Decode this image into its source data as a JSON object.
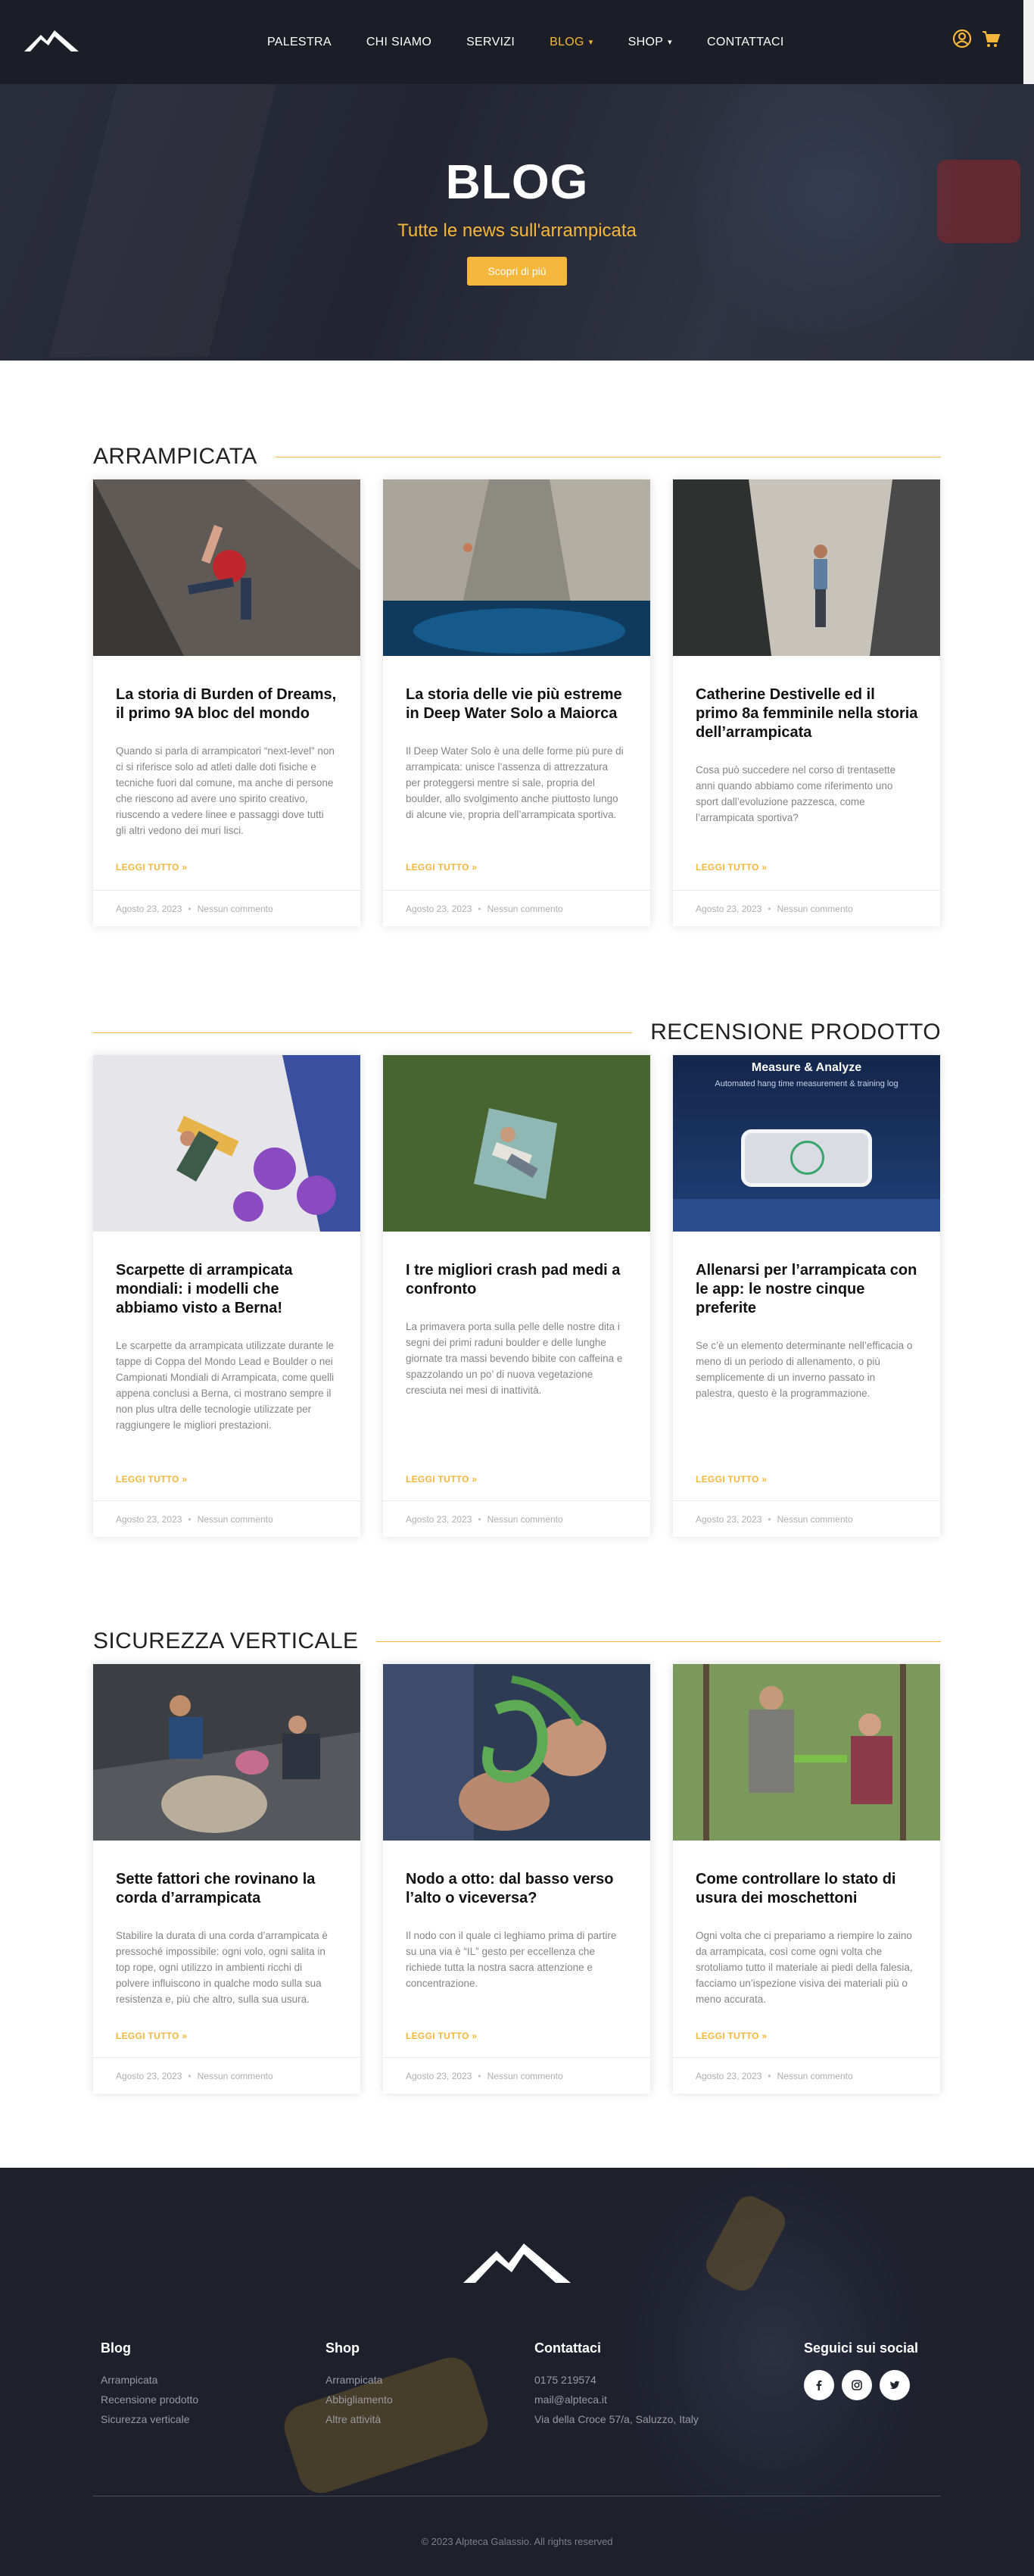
{
  "header": {
    "nav": [
      {
        "label": "PALESTRA"
      },
      {
        "label": "CHI SIAMO"
      },
      {
        "label": "SERVIZI"
      },
      {
        "label": "BLOG"
      },
      {
        "label": "SHOP"
      },
      {
        "label": "CONTATTACI"
      }
    ],
    "accent_color": "#f5b73b",
    "icons": [
      "user-icon",
      "cart-icon"
    ]
  },
  "hero": {
    "title": "BLOG",
    "subtitle": "Tutte le news sull'arrampicata",
    "button_label": "Scopri di più"
  },
  "sections": [
    {
      "title": "ARRAMPICATA",
      "cards": [
        {
          "title": "La storia di Burden of Dreams, il primo 9A bloc del mondo",
          "excerpt": "Quando si parla di arrampicatori “next-level” non ci si riferisce solo ad atleti dalle doti fisiche e tecniche fuori dal comune, ma anche di persone che riescono ad avere uno spirito creativo, riuscendo a vedere linee e passaggi dove tutti gli altri vedono dei muri lisci.",
          "read_more": "LEGGI TUTTO »",
          "date": "Agosto 23, 2023",
          "comments": "Nessun commento"
        },
        {
          "title": "La storia delle vie più estreme in Deep Water Solo a Maiorca",
          "excerpt": "Il Deep Water Solo è una delle forme più pure di arrampicata: unisce l’assenza di attrezzatura per proteggersi mentre si sale, propria del boulder, allo svolgimento anche piuttosto lungo di alcune vie, propria dell’arrampicata sportiva.",
          "read_more": "LEGGI TUTTO »",
          "date": "Agosto 23, 2023",
          "comments": "Nessun commento"
        },
        {
          "title": "Catherine Destivelle ed il primo 8a femminile nella storia dell’arrampicata",
          "excerpt": "Cosa può succedere nel corso di trentasette anni quando abbiamo come riferimento uno sport dall’evoluzione pazzesca, come l’arrampicata sportiva?",
          "read_more": "LEGGI TUTTO »",
          "date": "Agosto 23, 2023",
          "comments": "Nessun commento"
        }
      ]
    },
    {
      "title": "RECENSIONE PRODOTTO",
      "cards": [
        {
          "title": "Scarpette di arrampicata mondiali: i modelli che abbiamo visto a Berna!",
          "excerpt": "Le scarpette da arrampicata utilizzate durante le tappe di Coppa del Mondo Lead e Boulder o nei Campionati Mondiali di Arrampicata, come quelli appena conclusi a Berna, ci mostrano sempre il non plus ultra delle tecnologie utilizzate per raggiungere le migliori prestazioni.",
          "read_more": "LEGGI TUTTO »",
          "date": "Agosto 23, 2023",
          "comments": "Nessun commento"
        },
        {
          "title": "I tre migliori crash pad medi a confronto",
          "excerpt": "La primavera porta sulla pelle delle nostre dita i segni dei primi raduni boulder e delle lunghe giornate tra massi bevendo bibite con caffeina e spazzolando un po’ di nuova vegetazione cresciuta nei mesi di inattività.",
          "read_more": "LEGGI TUTTO »",
          "date": "Agosto 23, 2023",
          "comments": "Nessun commento"
        },
        {
          "title": "Allenarsi per l’arrampicata con le app: le nostre cinque preferite",
          "excerpt": "Se c’è un elemento determinante nell’efficacia o meno di un periodo di allenamento, o più semplicemente di un inverno passato in palestra, questo è la programmazione.",
          "read_more": "LEGGI TUTTO »",
          "date": "Agosto 23, 2023",
          "comments": "Nessun commento",
          "image_text_title": "Measure & Analyze",
          "image_text_sub": "Automated hang time measurement & training log"
        }
      ]
    },
    {
      "title": "SICUREZZA VERTICALE",
      "cards": [
        {
          "title": "Sette fattori che rovinano la corda d’arrampicata",
          "excerpt": "Stabilire la durata di una corda d’arrampicata è pressoché impossibile: ogni volo, ogni salita in top rope, ogni utilizzo in ambienti ricchi di polvere influiscono in qualche modo sulla sua resistenza e, più che altro, sulla sua usura.",
          "read_more": "LEGGI TUTTO »",
          "date": "Agosto 23, 2023",
          "comments": "Nessun commento"
        },
        {
          "title": "Nodo a otto: dal basso verso l’alto o viceversa?",
          "excerpt": "Il nodo con il quale ci leghiamo prima di partire su una via è “IL” gesto per eccellenza che richiede tutta la nostra sacra attenzione e concentrazione.",
          "read_more": "LEGGI TUTTO »",
          "date": "Agosto 23, 2023",
          "comments": "Nessun commento"
        },
        {
          "title": "Come controllare lo stato di usura dei moschettoni",
          "excerpt": "Ogni volta che ci prepariamo a riempire lo zaino da arrampicata, così come ogni volta che srotoliamo tutto il materiale ai piedi della falesia, facciamo un’ispezione visiva dei materiali più o meno accurata.",
          "read_more": "LEGGI TUTTO »",
          "date": "Agosto 23, 2023",
          "comments": "Nessun commento"
        }
      ]
    }
  ],
  "footer": {
    "blog": {
      "title": "Blog",
      "links": [
        "Arrampicata",
        "Recensione prodotto",
        "Sicurezza verticale"
      ]
    },
    "shop": {
      "title": "Shop",
      "links": [
        "Arrampicata",
        "Abbigliamento",
        "Altre attività"
      ]
    },
    "contacts": {
      "title": "Contattaci",
      "phone": "0175 219574",
      "email": "mail@alpteca.it",
      "address": "Via della Croce 57/a, Saluzzo, Italy"
    },
    "social": {
      "title": "Seguici sui social",
      "icons": [
        "facebook-icon",
        "instagram-icon",
        "twitter-icon"
      ]
    },
    "copyright": "© 2023 Alpteca Galassio. All rights reserved"
  }
}
